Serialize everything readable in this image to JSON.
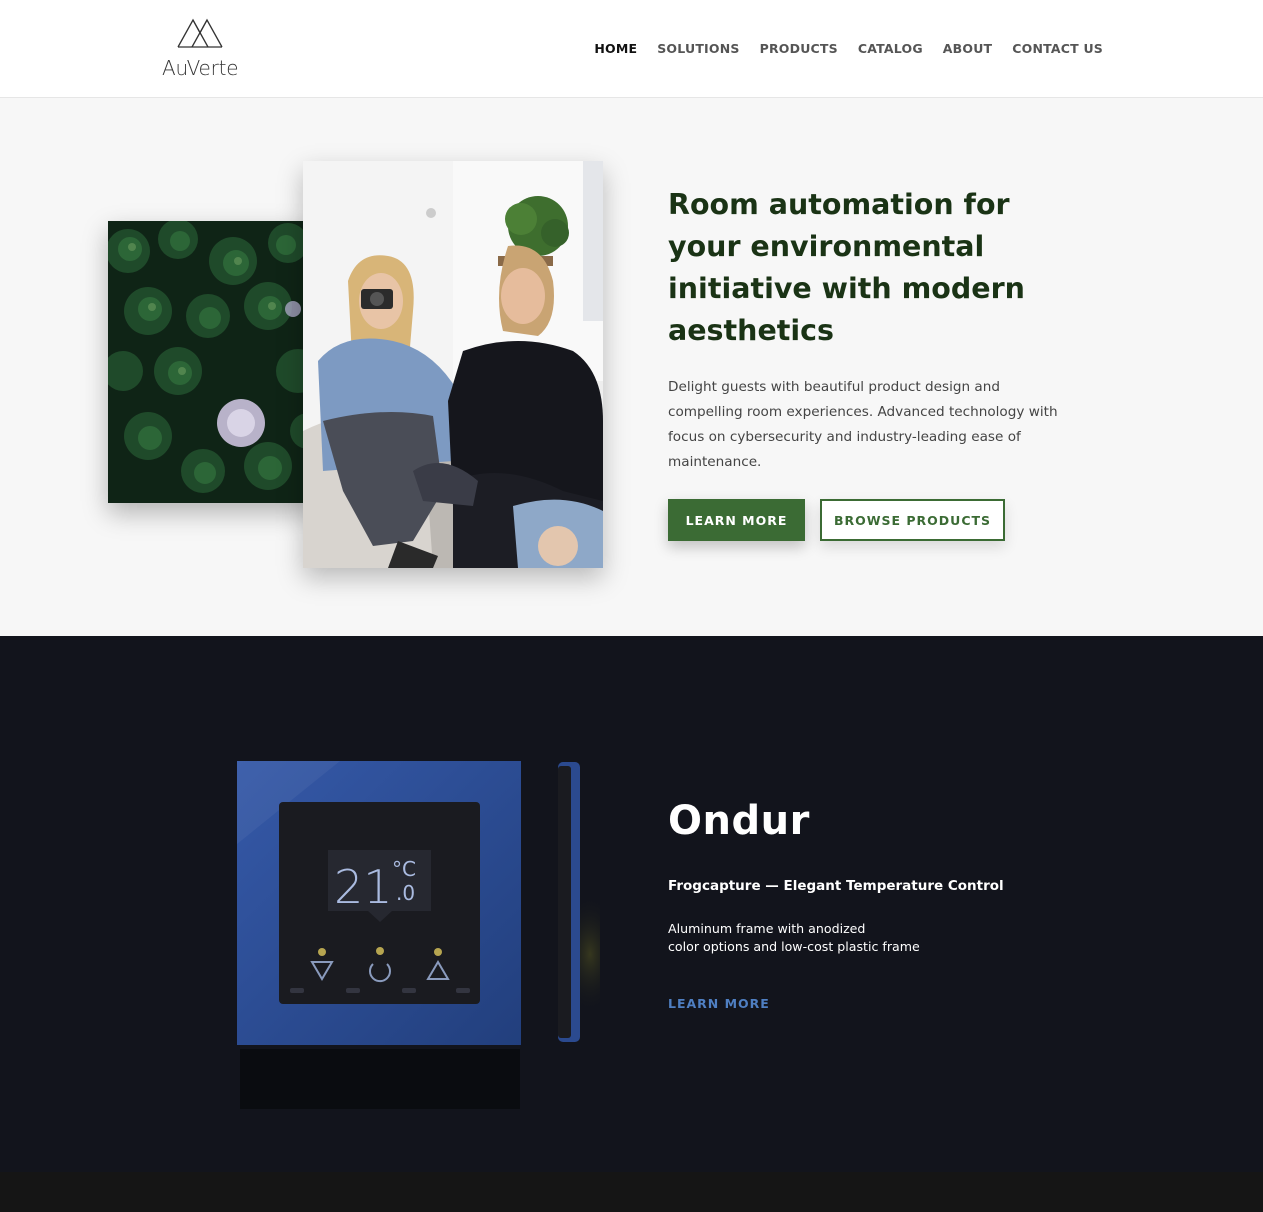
{
  "brand": {
    "name": "AuVerte",
    "icon": "mountain-logo-icon"
  },
  "nav": {
    "items": [
      {
        "label": "HOME",
        "active": true
      },
      {
        "label": "SOLUTIONS",
        "active": false
      },
      {
        "label": "PRODUCTS",
        "active": false
      },
      {
        "label": "CATALOG",
        "active": false
      },
      {
        "label": "ABOUT",
        "active": false
      },
      {
        "label": "CONTACT US",
        "active": false
      }
    ]
  },
  "hero": {
    "title": "Room automation for your environmental initiative with modern aesthetics",
    "description": "Delight guests with beautiful product design and compelling room experiences. Advanced technology with focus on cybersecurity and industry-leading ease of maintenance.",
    "primary_button": "LEARN MORE",
    "secondary_button": "BROWSE PRODUCTS",
    "images": [
      "forest-aerial-photo",
      "couple-camera-photo"
    ]
  },
  "product": {
    "title": "Ondur",
    "subtitle": "Frogcapture — Elegant Temperature Control",
    "description_lines": [
      "Aluminum frame with anodized",
      "color options and low-cost plastic frame"
    ],
    "link": "LEARN MORE",
    "display": {
      "temp_main": "21",
      "temp_unit": "°C",
      "temp_decimal": ".0"
    }
  },
  "colors": {
    "accent_green": "#3b6b34",
    "heading_green": "#1a3315",
    "product_bg": "#12141c",
    "link_blue": "#4f7fc2",
    "device_blue": "#2b4a8f"
  }
}
